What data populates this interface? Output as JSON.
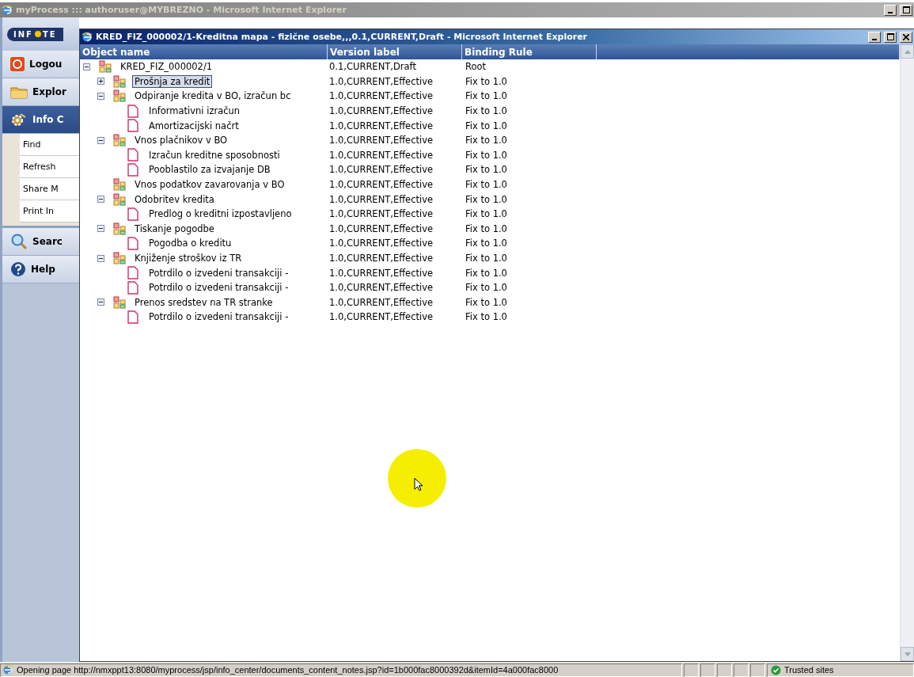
{
  "outer_window": {
    "title": "myProcess ::: authoruser@MYBREZNO - Microsoft Internet Explorer"
  },
  "sidebar": {
    "logo": [
      "INF",
      "TE"
    ],
    "items": [
      {
        "label": "Logou",
        "kind": "logout",
        "selected": false
      },
      {
        "label": "Explor",
        "kind": "explore",
        "selected": false
      },
      {
        "label": "Info C",
        "kind": "info",
        "selected": true,
        "children": [
          {
            "label": "Find"
          },
          {
            "label": "Refresh"
          },
          {
            "label": "Share M"
          },
          {
            "label": "Print In"
          }
        ]
      },
      {
        "label": "Searc",
        "kind": "search",
        "selected": false
      },
      {
        "label": "Help",
        "kind": "help",
        "selected": false
      }
    ]
  },
  "inner_window": {
    "title": "KRED_FIZ_000002/1-Kreditna mapa - fizične osebe,,,0.1,CURRENT,Draft - Microsoft Internet Explorer"
  },
  "table": {
    "columns": [
      "Object name",
      "Version label",
      "Binding Rule"
    ],
    "tree": [
      {
        "name": "KRED_FIZ_000002/1",
        "kind": "group",
        "expanded": true,
        "selected": false,
        "version": "0.1,CURRENT,Draft",
        "binding": "Root",
        "children": [
          {
            "name": "Prošnja za kredit",
            "kind": "group",
            "expanded": false,
            "selected": true,
            "version": "1.0,CURRENT,Effective",
            "binding": "Fix to 1.0"
          },
          {
            "name": "Odpiranje kredita v BO, izračun bc",
            "kind": "group",
            "expanded": true,
            "selected": false,
            "version": "1.0,CURRENT,Effective",
            "binding": "Fix to 1.0",
            "children": [
              {
                "name": "Informativni izračun",
                "kind": "document",
                "selected": false,
                "version": "1.0,CURRENT,Effective",
                "binding": "Fix to 1.0"
              },
              {
                "name": "Amortizacijski načrt",
                "kind": "document",
                "selected": false,
                "version": "1.0,CURRENT,Effective",
                "binding": "Fix to 1.0"
              }
            ]
          },
          {
            "name": "Vnos plačnikov v BO",
            "kind": "group",
            "expanded": true,
            "selected": false,
            "version": "1.0,CURRENT,Effective",
            "binding": "Fix to 1.0",
            "children": [
              {
                "name": "Izračun kreditne sposobnosti",
                "kind": "document",
                "selected": false,
                "version": "1.0,CURRENT,Effective",
                "binding": "Fix to 1.0"
              },
              {
                "name": "Pooblastilo za izvajanje DB",
                "kind": "document",
                "selected": false,
                "version": "1.0,CURRENT,Effective",
                "binding": "Fix to 1.0"
              }
            ]
          },
          {
            "name": "Vnos podatkov zavarovanja v BO",
            "kind": "group",
            "selected": false,
            "version": "1.0,CURRENT,Effective",
            "binding": "Fix to 1.0"
          },
          {
            "name": "Odobritev kredita",
            "kind": "group",
            "expanded": true,
            "selected": false,
            "version": "1.0,CURRENT,Effective",
            "binding": "Fix to 1.0",
            "children": [
              {
                "name": "Predlog o kreditni izpostavljeno",
                "kind": "document",
                "selected": false,
                "version": "1.0,CURRENT,Effective",
                "binding": "Fix to 1.0"
              }
            ]
          },
          {
            "name": "Tiskanje pogodbe",
            "kind": "group",
            "expanded": true,
            "selected": false,
            "version": "1.0,CURRENT,Effective",
            "binding": "Fix to 1.0",
            "children": [
              {
                "name": "Pogodba o kreditu",
                "kind": "document",
                "selected": false,
                "version": "1.0,CURRENT,Effective",
                "binding": "Fix to 1.0"
              }
            ]
          },
          {
            "name": "Knjiženje stroškov iz TR",
            "kind": "group",
            "expanded": true,
            "selected": false,
            "version": "1.0,CURRENT,Effective",
            "binding": "Fix to 1.0",
            "children": [
              {
                "name": "Potrdilo o izvedeni transakciji -",
                "kind": "document",
                "selected": false,
                "version": "1.0,CURRENT,Effective",
                "binding": "Fix to 1.0"
              },
              {
                "name": "Potrdilo o izvedeni transakciji -",
                "kind": "document",
                "selected": false,
                "version": "1.0,CURRENT,Effective",
                "binding": "Fix to 1.0"
              }
            ]
          },
          {
            "name": "Prenos sredstev na TR stranke",
            "kind": "group",
            "expanded": true,
            "selected": false,
            "version": "1.0,CURRENT,Effective",
            "binding": "Fix to 1.0",
            "children": [
              {
                "name": "Potrdilo o izvedeni transakciji -",
                "kind": "document",
                "selected": false,
                "version": "1.0,CURRENT,Effective",
                "binding": "Fix to 1.0"
              }
            ]
          }
        ]
      }
    ]
  },
  "status_bar": {
    "text": "Opening page http://nmxppt13:8080/myprocess/jsp/info_center/documents_content_notes.jsp?id=1b000fac8000392d&itemId=4a000fac8000",
    "zone": "Trusted sites"
  }
}
